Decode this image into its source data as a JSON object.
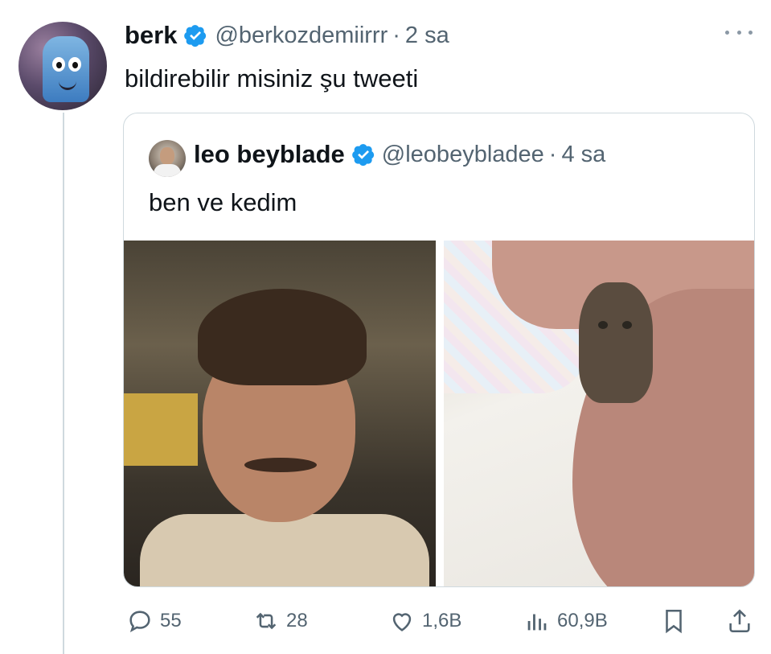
{
  "tweet": {
    "author_name": "berk",
    "handle": "@berkozdemiirrr",
    "separator": "·",
    "time": "2 sa",
    "text": "bildirebilir misiniz şu tweeti"
  },
  "quoted_tweet": {
    "author_name": "leo beyblade",
    "handle": "@leobeybladee",
    "separator": "·",
    "time": "4 sa",
    "text": "ben ve kedim"
  },
  "actions": {
    "replies": "55",
    "retweets": "28",
    "likes": "1,6B",
    "views": "60,9B"
  },
  "colors": {
    "verified": "#1d9bf0",
    "muted": "#536471",
    "border": "#cfd9de"
  }
}
